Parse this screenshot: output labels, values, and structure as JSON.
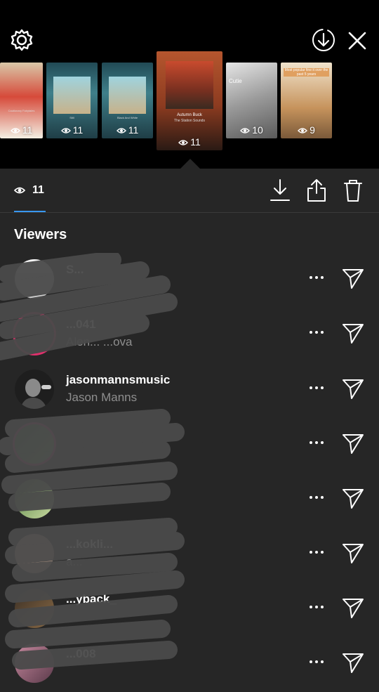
{
  "topbar": {
    "settings_icon": "settings-gear-icon",
    "download_icon": "download-circle-icon",
    "close_icon": "close-icon"
  },
  "stories": [
    {
      "count": "11",
      "title": "Cautionary Fairytales",
      "subtitle": "Dick Jr. & the Handshakes",
      "colors": [
        "#e8e0d0",
        "#c0392b"
      ],
      "selected": false
    },
    {
      "count": "11",
      "title": "Still",
      "subtitle": "Matt Maeson",
      "colors": [
        "#2f5a66",
        "#88c1c9"
      ],
      "selected": false
    },
    {
      "count": "11",
      "title": "Black And White",
      "subtitle": "Niall Horan",
      "colors": [
        "#2d5f6a",
        "#7ab7bd"
      ],
      "selected": false
    },
    {
      "count": "11",
      "title": "Autumn Buck",
      "subtitle": "The Station Sounds",
      "colors": [
        "#b04a2a",
        "#2a2a2a"
      ],
      "selected": true
    },
    {
      "count": "10",
      "title": "Cutie",
      "subtitle": "",
      "colors": [
        "#a0a0a0",
        "#d8d8d8"
      ],
      "selected": false
    },
    {
      "count": "9",
      "title": "Most popular fine it over the past 5 years",
      "subtitle": "",
      "colors": [
        "#c59a6a",
        "#e7d8c4"
      ],
      "selected": false
    }
  ],
  "stats": {
    "views": "11"
  },
  "viewers_title": "Viewers",
  "viewers": [
    {
      "username": "S...",
      "fullname": "",
      "obscured": true
    },
    {
      "username": "...041",
      "fullname": "Alen... ...ova",
      "obscured": true
    },
    {
      "username": "jasonmannsmusic",
      "fullname": "Jason Manns",
      "obscured": false
    },
    {
      "username": "",
      "fullname": "",
      "obscured": true
    },
    {
      "username": "",
      "fullname": "",
      "obscured": true
    },
    {
      "username": "...kokli...",
      "fullname": "a...",
      "obscured": true
    },
    {
      "username": "...yback_",
      "fullname": "",
      "obscured": true
    },
    {
      "username": "...008",
      "fullname": "",
      "obscured": true
    }
  ],
  "colors": {
    "background": "#262626",
    "accent": "#3897f0",
    "secondary_text": "#8e8e8e"
  }
}
